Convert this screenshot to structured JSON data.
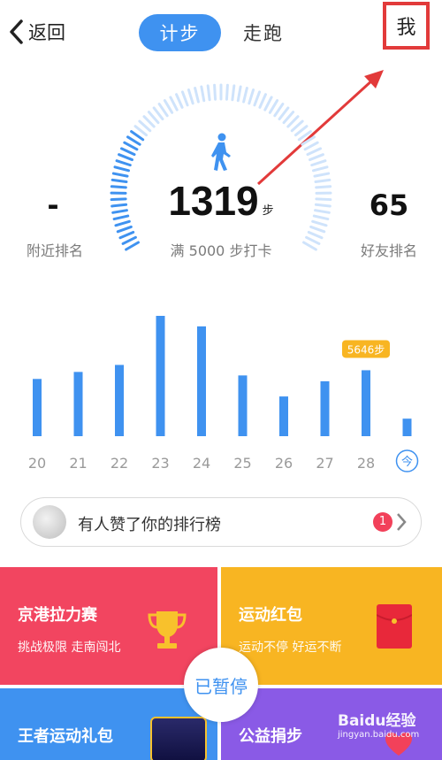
{
  "topbar": {
    "back_label": "返回",
    "tabs": [
      {
        "label": "计步",
        "active": true
      },
      {
        "label": "走跑",
        "active": false
      }
    ],
    "me_label": "我"
  },
  "gauge": {
    "steps": "1319",
    "steps_unit": "步",
    "goal_text": "满 5000 步打卡",
    "nearby_rank_value": "-",
    "nearby_rank_label": "附近排名",
    "friend_rank_value": "65",
    "friend_rank_label": "好友排名",
    "icon": "walker-icon"
  },
  "chart_data": {
    "type": "bar",
    "categories": [
      "20",
      "21",
      "22",
      "23",
      "24",
      "25",
      "26",
      "27",
      "28",
      "今"
    ],
    "values": [
      4900,
      5500,
      6100,
      10300,
      9400,
      5200,
      3400,
      4700,
      5646,
      1500
    ],
    "annotation": "5646步",
    "highlight_index": 8,
    "color": "#3f92f0"
  },
  "notice": {
    "text": "有人赞了你的排行榜",
    "badge": "1"
  },
  "tiles": [
    {
      "title": "京港拉力赛",
      "subtitle": "挑战极限 走南闯北",
      "color": "#f24560",
      "icon": "trophy-icon"
    },
    {
      "title": "运动红包",
      "subtitle": "运动不停 好运不断",
      "color": "#f8b522",
      "icon": "red-envelope-icon"
    },
    {
      "title": "王者运动礼包",
      "subtitle": "",
      "color": "#3f92f0",
      "icon": "game-banner-icon"
    },
    {
      "title": "公益捐步",
      "subtitle": "",
      "color": "#8a5ae6",
      "icon": "heart-icon"
    }
  ],
  "pause_label": "已暂停",
  "watermark": "Baidu经验",
  "watermark_sub": "jingyan.baidu.com"
}
